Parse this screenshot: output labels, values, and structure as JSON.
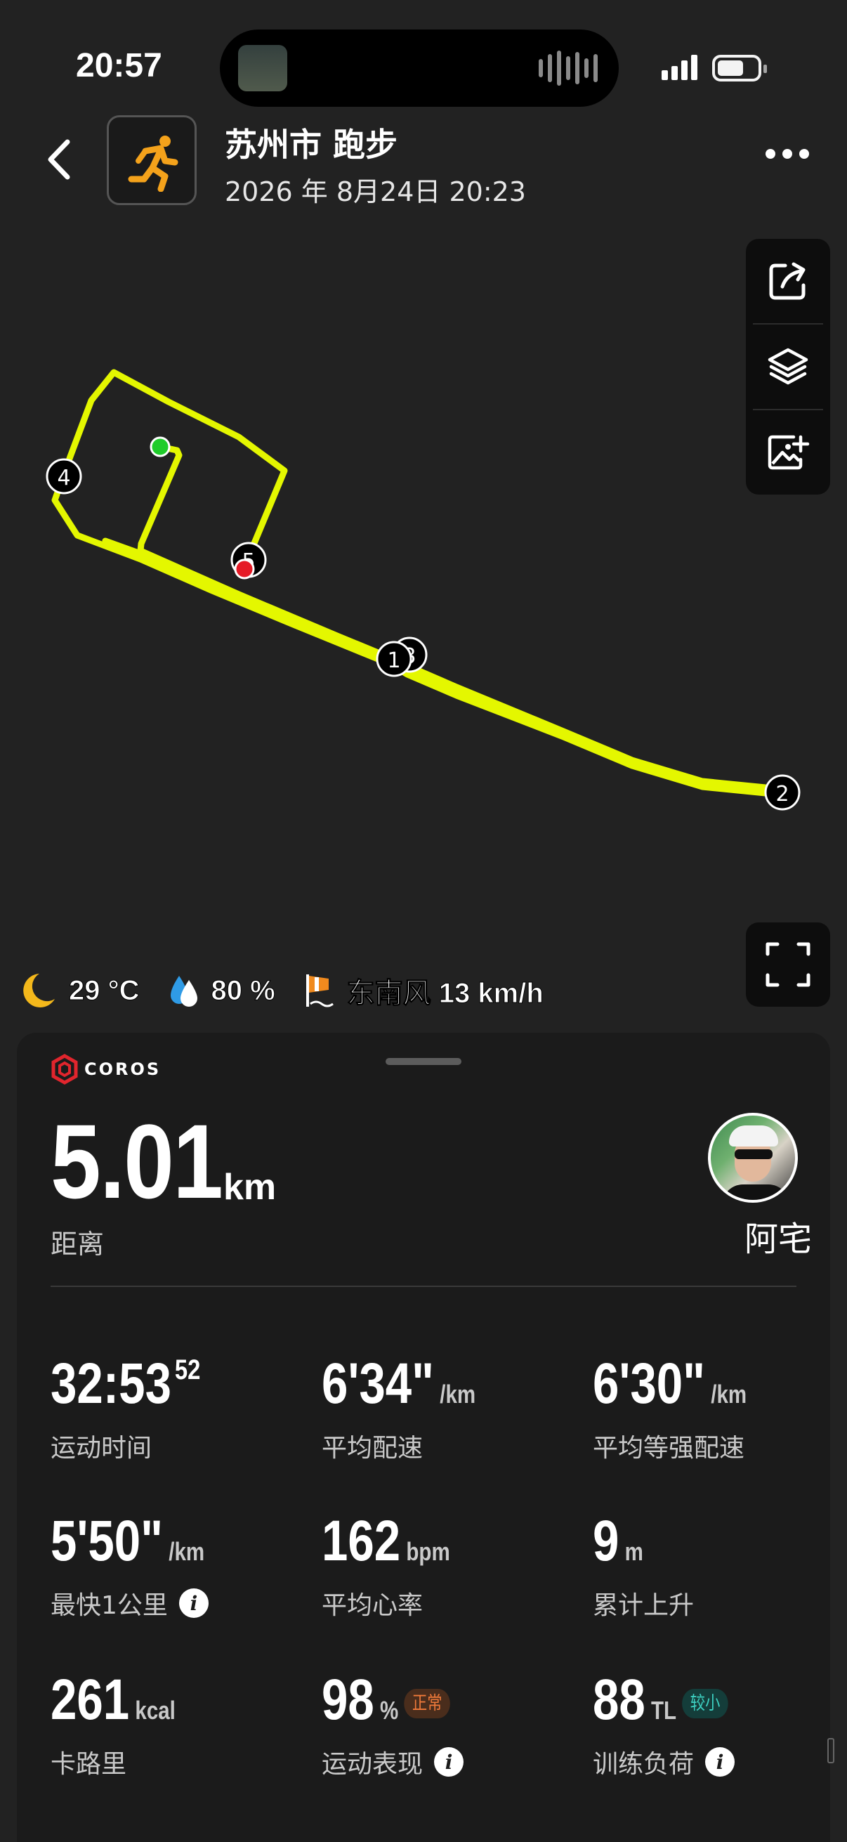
{
  "status_bar": {
    "time": "20:57"
  },
  "header": {
    "title": "苏州市 跑步",
    "subtitle": "2026 年 8月24日 20:23",
    "activity_icon": "running-person-icon"
  },
  "map": {
    "track_color": "#e4f700",
    "start_color": "#1fcc2a",
    "end_color": "#e51a26",
    "km_markers": [
      "1",
      "2",
      "3",
      "4",
      "5"
    ],
    "tools": [
      "share-icon",
      "layers-icon",
      "add-image-icon"
    ],
    "fullscreen_icon": "fullscreen-icon"
  },
  "weather": {
    "temperature": "29 °C",
    "humidity": "80 %",
    "wind": "东南风 13 km/h"
  },
  "summary": {
    "brand": "COROS",
    "distance_value": "5.01",
    "distance_unit": "km",
    "distance_label": "距离",
    "username": "阿宅"
  },
  "stats": [
    {
      "value": "32:53",
      "sup": "52",
      "unit": "",
      "label": "运动时间"
    },
    {
      "value": "6'34\"",
      "unit": "/km",
      "label": "平均配速"
    },
    {
      "value": "6'30\"",
      "unit": "/km",
      "label": "平均等强配速"
    },
    {
      "value": "5'50\"",
      "unit": "/km",
      "label": "最快1公里",
      "info": "i"
    },
    {
      "value": "162",
      "unit": "bpm",
      "label": "平均心率"
    },
    {
      "value": "9",
      "unit": "m",
      "label": "累计上升"
    },
    {
      "value": "261",
      "unit": "kcal",
      "label": "卡路里"
    },
    {
      "value": "98",
      "unit": "%",
      "badge": "正常",
      "label": "运动表现",
      "info": "i"
    },
    {
      "value": "88",
      "unit": "TL",
      "badge": "较小",
      "label": "训练负荷",
      "info": "i"
    }
  ]
}
